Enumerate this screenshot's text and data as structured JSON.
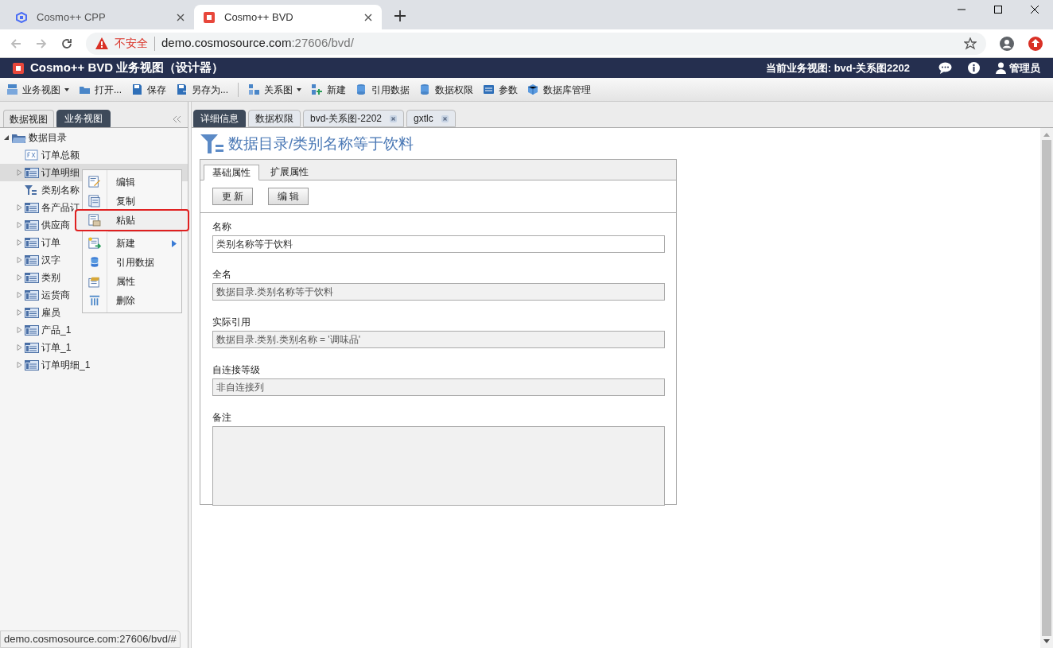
{
  "browser": {
    "tabs": [
      {
        "title": "Cosmo++ CPP",
        "selected": false
      },
      {
        "title": "Cosmo++ BVD",
        "selected": true
      }
    ],
    "security": "不安全",
    "url_host": "demo.cosmosource.com",
    "url_path": ":27606/bvd/"
  },
  "app": {
    "title": "Cosmo++ BVD 业务视图（设计器）",
    "current_view": "当前业务视图: bvd-关系图2202",
    "user": "管理员"
  },
  "toolbar": [
    {
      "label": "业务视图",
      "kind": "dropdown"
    },
    {
      "label": "打开...",
      "kind": "button"
    },
    {
      "label": "保存",
      "kind": "button"
    },
    {
      "label": "另存为...",
      "kind": "button"
    },
    {
      "kind": "separator"
    },
    {
      "label": "关系图",
      "kind": "dropdown"
    },
    {
      "label": "新建",
      "kind": "button"
    },
    {
      "label": "引用数据",
      "kind": "button"
    },
    {
      "label": "数据权限",
      "kind": "button"
    },
    {
      "label": "参数",
      "kind": "button"
    },
    {
      "label": "数据库管理",
      "kind": "button"
    }
  ],
  "left_tabs": [
    {
      "label": "数据视图",
      "selected": false
    },
    {
      "label": "业务视图",
      "selected": true
    }
  ],
  "tree": [
    {
      "label": "数据目录",
      "kind": "folder",
      "expanded": true,
      "selected": false,
      "children": [
        {
          "label": "订单总额",
          "kind": "formula",
          "selected": false
        },
        {
          "label": "订单明细",
          "kind": "table",
          "expanded": false,
          "selected": true
        },
        {
          "label": "类别名称",
          "kind": "filter",
          "selected": false
        },
        {
          "label": "各产品订",
          "kind": "table",
          "expanded": false,
          "selected": false
        },
        {
          "label": "供应商",
          "kind": "table",
          "expanded": false,
          "selected": false
        },
        {
          "label": "订单",
          "kind": "table",
          "expanded": false,
          "selected": false
        },
        {
          "label": "汉字",
          "kind": "table",
          "expanded": false,
          "selected": false
        },
        {
          "label": "类别",
          "kind": "table",
          "expanded": false,
          "selected": false
        },
        {
          "label": "运货商",
          "kind": "table",
          "expanded": false,
          "selected": false
        },
        {
          "label": "雇员",
          "kind": "table",
          "expanded": false,
          "selected": false
        },
        {
          "label": "产品_1",
          "kind": "table",
          "expanded": false,
          "selected": false
        },
        {
          "label": "订单_1",
          "kind": "table",
          "expanded": false,
          "selected": false
        },
        {
          "label": "订单明细_1",
          "kind": "table",
          "expanded": false,
          "selected": false
        }
      ]
    }
  ],
  "context_menu": [
    {
      "label": "编辑",
      "highlighted": false,
      "submenu": false
    },
    {
      "label": "复制",
      "highlighted": false,
      "submenu": false
    },
    {
      "label": "粘贴",
      "highlighted": true,
      "submenu": false
    },
    {
      "label": "新建",
      "highlighted": false,
      "submenu": true
    },
    {
      "label": "引用数据",
      "highlighted": false,
      "submenu": false
    },
    {
      "label": "属性",
      "highlighted": false,
      "submenu": false
    },
    {
      "label": "删除",
      "highlighted": false,
      "submenu": false
    }
  ],
  "main_tabs": [
    {
      "label": "详细信息",
      "selected": true,
      "closable": false
    },
    {
      "label": "数据权限",
      "selected": false,
      "closable": false
    },
    {
      "label": "bvd-关系图-2202",
      "selected": false,
      "closable": true
    },
    {
      "label": "gxtlc",
      "selected": false,
      "closable": true
    }
  ],
  "heading": "数据目录/类别名称等于饮料",
  "prop_tabs": [
    {
      "label": "基础属性",
      "selected": true
    },
    {
      "label": "扩展属性",
      "selected": false
    }
  ],
  "buttons": [
    "更 新",
    "编 辑"
  ],
  "fields": [
    {
      "label": "名称",
      "value": "类别名称等于饮料",
      "readonly": false,
      "kind": "text"
    },
    {
      "label": "全名",
      "value": "数据目录.类别名称等于饮料",
      "readonly": true,
      "kind": "text"
    },
    {
      "label": "实际引用",
      "value": "数据目录.类别.类别名称 = '调味品'",
      "readonly": true,
      "kind": "text"
    },
    {
      "label": "自连接等级",
      "value": "非自连接列",
      "readonly": true,
      "kind": "text"
    },
    {
      "label": "备注",
      "readonly": true,
      "kind": "textarea"
    }
  ],
  "status_url": "demo.cosmosource.com:27606/bvd/#"
}
